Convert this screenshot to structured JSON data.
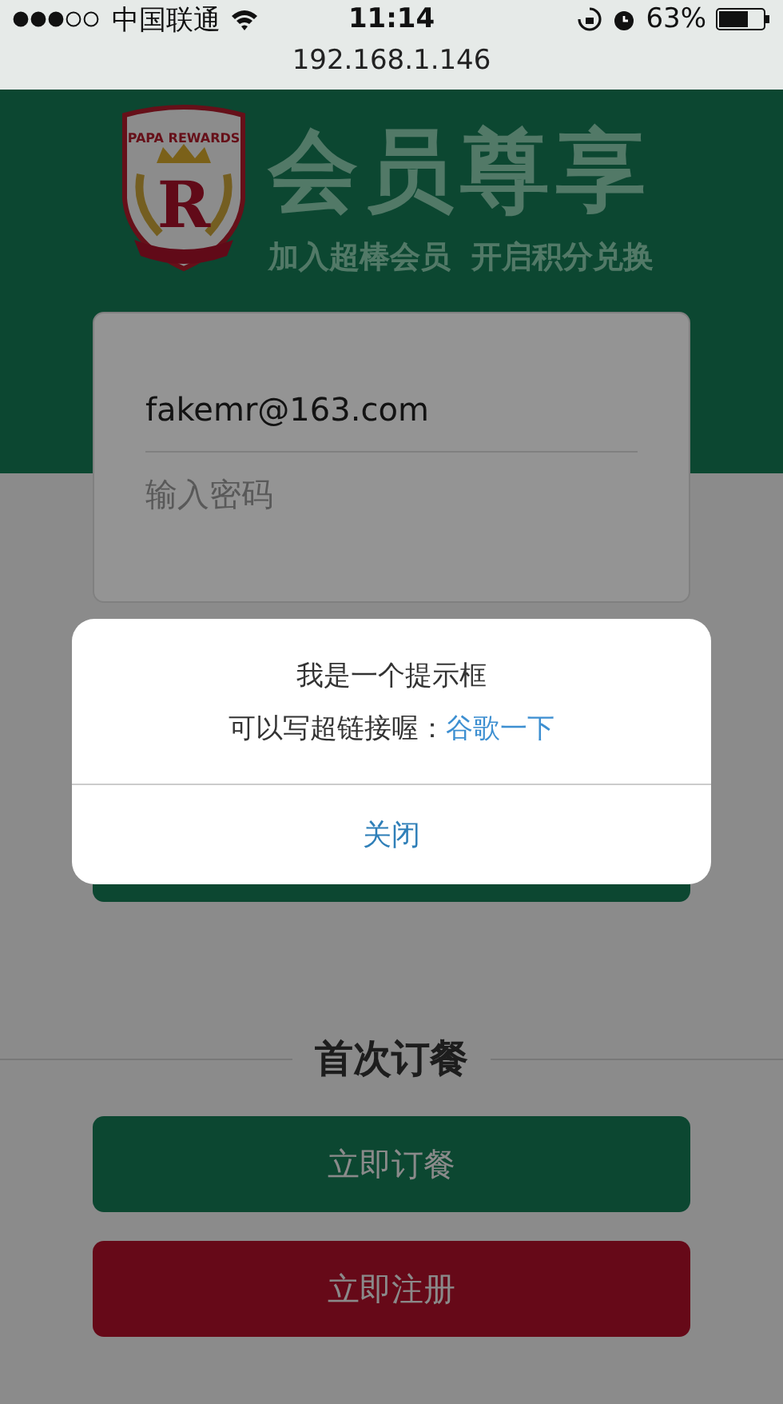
{
  "status_bar": {
    "carrier": "中国联通",
    "time": "11:14",
    "battery": "63%"
  },
  "address_bar": {
    "url": "192.168.1.146"
  },
  "header": {
    "logo_top": "PAPA REWARDS",
    "logo_letter": "R",
    "title": "会员尊享",
    "subtitle": "加入超棒会员  开启积分兑换"
  },
  "login_form": {
    "email": {
      "value": "fakemr@163.com"
    },
    "password": {
      "placeholder": "输入密码"
    }
  },
  "section": {
    "title": "首次订餐"
  },
  "buttons": [
    {
      "label": "立即订餐",
      "kind": "primary"
    },
    {
      "label": "立即注册",
      "kind": "danger"
    }
  ],
  "alert": {
    "message": "我是一个提示框",
    "link_prefix": "可以写超链接喔：",
    "link": "谷歌一下",
    "button": "关闭"
  }
}
